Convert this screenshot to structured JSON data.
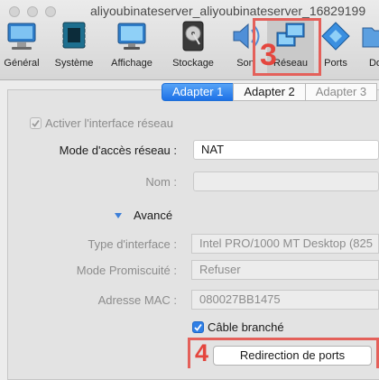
{
  "window": {
    "title": "aliyoubinateserver_aliyoubinateserver_16829199"
  },
  "toolbar": {
    "items": [
      {
        "label": "Général",
        "icon": "general-settings-icon"
      },
      {
        "label": "Système",
        "icon": "chip-icon"
      },
      {
        "label": "Affichage",
        "icon": "monitor-icon"
      },
      {
        "label": "Stockage",
        "icon": "disk-icon"
      },
      {
        "label": "Son",
        "icon": "speaker-icon"
      },
      {
        "label": "Réseau",
        "icon": "network-icon"
      },
      {
        "label": "Ports",
        "icon": "ports-icon"
      },
      {
        "label": "Do",
        "icon": "shared-folder-icon"
      }
    ]
  },
  "annotations": {
    "step_network": "3",
    "step_port_forward": "4"
  },
  "tabs": [
    "Adapter 1",
    "Adapter 2",
    "Adapter 3"
  ],
  "adapter": {
    "enable_label": "Activer l'interface réseau",
    "mode_label": "Mode d'accès réseau :",
    "mode_value": "NAT",
    "name_label": "Nom :",
    "name_value": "",
    "advanced_label": "Avancé",
    "type_label": "Type d'interface :",
    "type_value": "Intel PRO/1000 MT Desktop (825",
    "promisc_label": "Mode Promiscuité :",
    "promisc_value": "Refuser",
    "mac_label": "Adresse MAC :",
    "mac_value": "080027BB1475",
    "cable_label": "Câble branché",
    "port_forward_label": "Redirection de ports"
  },
  "colors": {
    "accent": "#1d71e7",
    "highlight": "#e4605a"
  }
}
